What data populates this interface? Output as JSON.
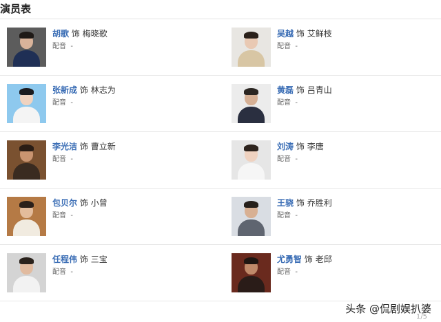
{
  "section_title": "演员表",
  "cast": [
    {
      "name": "胡歌",
      "connector": "饰",
      "role": "梅晓歌",
      "dub_label": "配音",
      "dub_value": "-",
      "colors": {
        "bg": "#5c5c5c",
        "skin": "#d9b39a",
        "hair": "#1f1a17",
        "cloth": "#1f2f55"
      }
    },
    {
      "name": "吴越",
      "connector": "饰",
      "role": "艾鲜枝",
      "dub_label": "配音",
      "dub_value": "-",
      "colors": {
        "bg": "#e8e6e2",
        "skin": "#e9c9b3",
        "hair": "#2a201a",
        "cloth": "#d8c6a4"
      }
    },
    {
      "name": "张新成",
      "connector": "饰",
      "role": "林志为",
      "dub_label": "配音",
      "dub_value": "-",
      "colors": {
        "bg": "#8ec9ee",
        "skin": "#f0d3c0",
        "hair": "#1b1b1f",
        "cloth": "#f4f4f4"
      }
    },
    {
      "name": "黄磊",
      "connector": "饰",
      "role": "吕青山",
      "dub_label": "配音",
      "dub_value": "-",
      "colors": {
        "bg": "#ececec",
        "skin": "#d6b095",
        "hair": "#2b2622",
        "cloth": "#2a2f40"
      }
    },
    {
      "name": "李光洁",
      "connector": "饰",
      "role": "曹立新",
      "dub_label": "配音",
      "dub_value": "-",
      "colors": {
        "bg": "#7a5130",
        "skin": "#c99470",
        "hair": "#2a1d15",
        "cloth": "#3a2b20"
      }
    },
    {
      "name": "刘涛",
      "connector": "饰",
      "role": "李唐",
      "dub_label": "配音",
      "dub_value": "-",
      "colors": {
        "bg": "#e6e6e6",
        "skin": "#efd2c0",
        "hair": "#2e241e",
        "cloth": "#f6f6f6"
      }
    },
    {
      "name": "包贝尔",
      "connector": "饰",
      "role": "小曾",
      "dub_label": "配音",
      "dub_value": "-",
      "colors": {
        "bg": "#b57a45",
        "skin": "#e3bc9c",
        "hair": "#2b201a",
        "cloth": "#f1ebe0"
      }
    },
    {
      "name": "王骁",
      "connector": "饰",
      "role": "乔胜利",
      "dub_label": "配音",
      "dub_value": "-",
      "colors": {
        "bg": "#d9dde3",
        "skin": "#d8b093",
        "hair": "#26201b",
        "cloth": "#5f6570"
      }
    },
    {
      "name": "任程伟",
      "connector": "饰",
      "role": "三宝",
      "dub_label": "配音",
      "dub_value": "-",
      "colors": {
        "bg": "#d4d4d4",
        "skin": "#e1bba0",
        "hair": "#2a221c",
        "cloth": "#f2f2f2"
      }
    },
    {
      "name": "尤勇智",
      "connector": "饰",
      "role": "老邱",
      "dub_label": "配音",
      "dub_value": "-",
      "colors": {
        "bg": "#6a2a1e",
        "skin": "#c08a6a",
        "hair": "#1f1612",
        "cloth": "#2a1c18"
      }
    }
  ],
  "watermark": "头条 @侃剧娱扒婆",
  "watermark_small": "1/5"
}
